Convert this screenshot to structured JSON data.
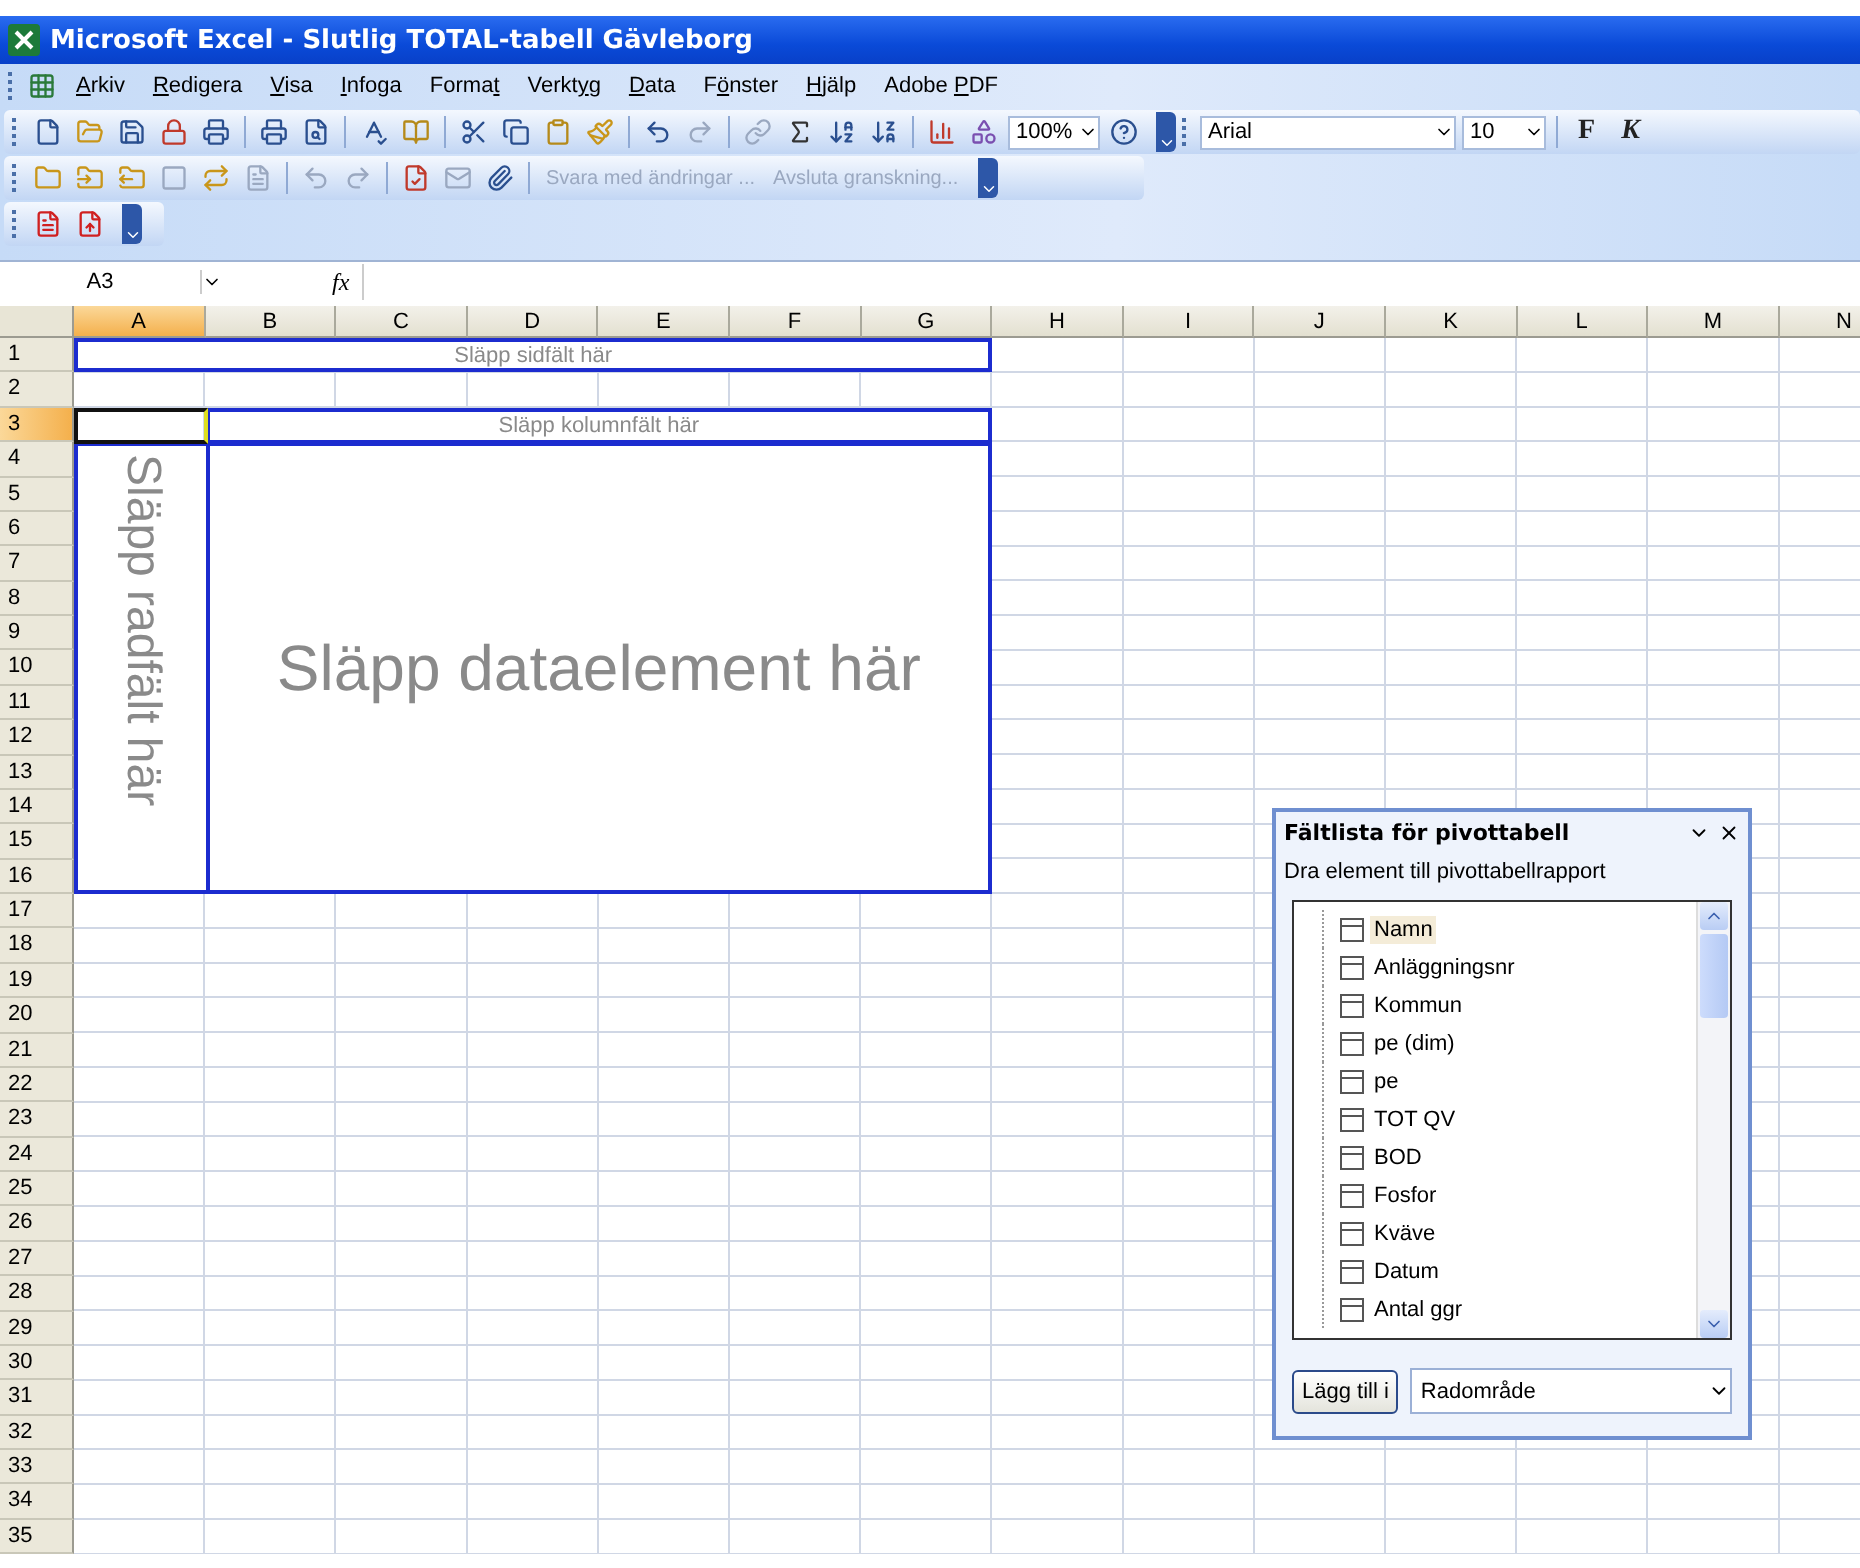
{
  "window": {
    "title": "Microsoft Excel - Slutlig TOTAL-tabell Gävleborg"
  },
  "menu": [
    {
      "key": "A",
      "post": "rkiv"
    },
    {
      "key": "R",
      "post": "edigera"
    },
    {
      "key": "V",
      "post": "isa"
    },
    {
      "key": "I",
      "post": "nfoga"
    },
    {
      "pre": "Forma",
      "key": "t"
    },
    {
      "pre": "Verkt",
      "key": "y",
      "post": "g"
    },
    {
      "key": "D",
      "post": "ata"
    },
    {
      "pre": "F",
      "key": "ö",
      "post": "nster"
    },
    {
      "key": "H",
      "post": "jälp"
    },
    {
      "pre": "Adobe ",
      "key": "P",
      "post": "DF"
    }
  ],
  "standard_toolbar": {
    "zoom": "100%",
    "font": "Arial",
    "font_size": "10",
    "bold": "F",
    "italic": "K"
  },
  "review_toolbar": {
    "buttons": [
      {
        "label": "Svara med ändringar ...",
        "disabled": true
      },
      {
        "label": "Avsluta granskning...",
        "disabled": true
      }
    ]
  },
  "formula_bar": {
    "name_box": "A3",
    "fx": "fx"
  },
  "sheet": {
    "columns": [
      {
        "label": "A",
        "selected": true
      },
      {
        "label": "B",
        "selected": false
      },
      {
        "label": "C",
        "selected": false
      },
      {
        "label": "D",
        "selected": false
      },
      {
        "label": "E",
        "selected": false
      },
      {
        "label": "F",
        "selected": false
      },
      {
        "label": "G",
        "selected": false
      },
      {
        "label": "H",
        "selected": false
      },
      {
        "label": "I",
        "selected": false
      },
      {
        "label": "J",
        "selected": false
      },
      {
        "label": "K",
        "selected": false
      },
      {
        "label": "L",
        "selected": false
      },
      {
        "label": "M",
        "selected": false
      },
      {
        "label": "N",
        "selected": false
      }
    ],
    "rows": [
      {
        "label": "1",
        "selected": false
      },
      {
        "label": "2",
        "selected": false
      },
      {
        "label": "3",
        "selected": true
      },
      {
        "label": "4",
        "selected": false
      },
      {
        "label": "5",
        "selected": false
      },
      {
        "label": "6",
        "selected": false
      },
      {
        "label": "7",
        "selected": false
      },
      {
        "label": "8",
        "selected": false
      },
      {
        "label": "9",
        "selected": false
      },
      {
        "label": "10",
        "selected": false
      },
      {
        "label": "11",
        "selected": false
      },
      {
        "label": "12",
        "selected": false
      },
      {
        "label": "13",
        "selected": false
      },
      {
        "label": "14",
        "selected": false
      },
      {
        "label": "15",
        "selected": false
      },
      {
        "label": "16",
        "selected": false
      },
      {
        "label": "17",
        "selected": false
      },
      {
        "label": "18",
        "selected": false
      },
      {
        "label": "19",
        "selected": false
      },
      {
        "label": "20",
        "selected": false
      },
      {
        "label": "21",
        "selected": false
      },
      {
        "label": "22",
        "selected": false
      },
      {
        "label": "23",
        "selected": false
      },
      {
        "label": "24",
        "selected": false
      },
      {
        "label": "25",
        "selected": false
      },
      {
        "label": "26",
        "selected": false
      },
      {
        "label": "27",
        "selected": false
      },
      {
        "label": "28",
        "selected": false
      },
      {
        "label": "29",
        "selected": false
      },
      {
        "label": "30",
        "selected": false
      },
      {
        "label": "31",
        "selected": false
      },
      {
        "label": "32",
        "selected": false
      },
      {
        "label": "33",
        "selected": false
      },
      {
        "label": "34",
        "selected": false
      },
      {
        "label": "35",
        "selected": false
      }
    ]
  },
  "pivot": {
    "page_drop": "Släpp sidfält här",
    "column_drop": "Släpp kolumnfält här",
    "row_drop": "Släpp radfält här",
    "data_drop": "Släpp dataelement här"
  },
  "field_list": {
    "title": "Fältlista för pivottabell",
    "hint": "Dra element till pivottabellrapport",
    "fields": [
      {
        "label": "Namn",
        "selected": true
      },
      {
        "label": "Anläggningsnr",
        "selected": false
      },
      {
        "label": "Kommun",
        "selected": false
      },
      {
        "label": "pe (dim)",
        "selected": false
      },
      {
        "label": "pe",
        "selected": false
      },
      {
        "label": "TOT QV",
        "selected": false
      },
      {
        "label": "BOD",
        "selected": false
      },
      {
        "label": "Fosfor",
        "selected": false
      },
      {
        "label": "Kväve",
        "selected": false
      },
      {
        "label": "Datum",
        "selected": false
      },
      {
        "label": "Antal ggr",
        "selected": false
      }
    ],
    "add_button": "Lägg till i",
    "area": "Radområde"
  }
}
